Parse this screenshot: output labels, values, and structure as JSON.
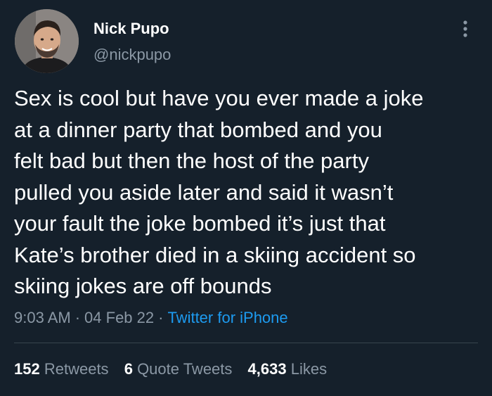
{
  "author": {
    "display_name": "Nick Pupo",
    "handle": "@nickpupo"
  },
  "tweet": {
    "text": "Sex is cool but have you ever made a joke\nat a dinner party that bombed and you\nfelt bad but then the host of the party\npulled you aside later and said it wasn’t\nyour fault the joke bombed it’s just that\nKate’s brother died in a skiing accident so\nskiing jokes are off bounds",
    "time": "9:03 AM",
    "date": "04 Feb 22",
    "separator": "·",
    "source": "Twitter for iPhone"
  },
  "stats": {
    "retweets_count": "152",
    "retweets_label": "Retweets",
    "quotes_count": "6",
    "quotes_label": "Quote Tweets",
    "likes_count": "4,633",
    "likes_label": "Likes"
  },
  "icons": {
    "more": "more-vertical-icon",
    "avatar": "profile-photo"
  },
  "colors": {
    "background": "#15202b",
    "primary_text": "#ffffff",
    "secondary_text": "#8b98a5",
    "link": "#1d9bf0",
    "divider": "#38444d"
  }
}
